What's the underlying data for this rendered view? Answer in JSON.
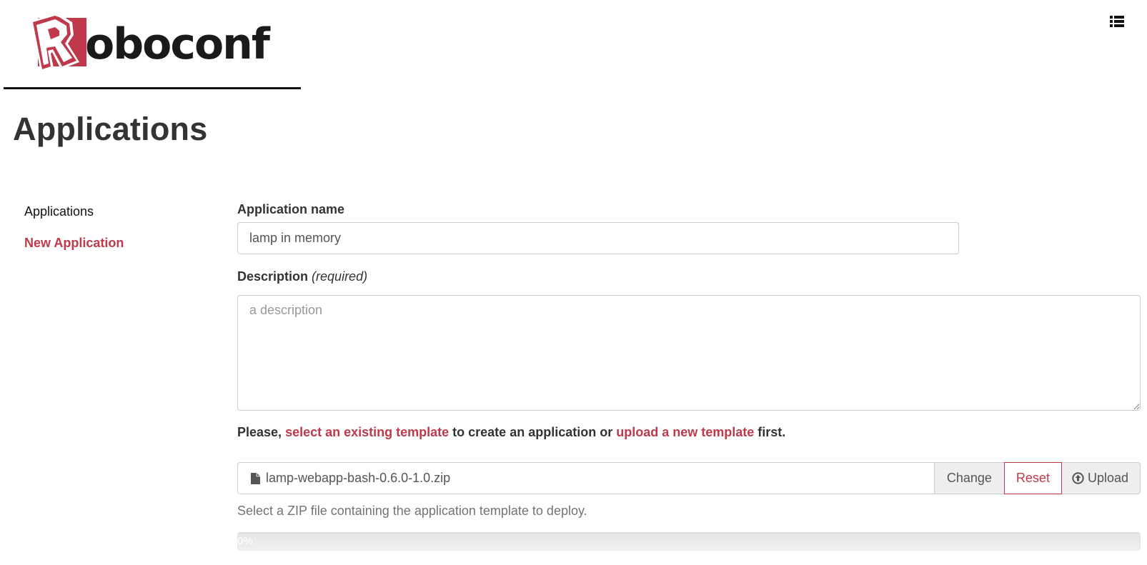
{
  "brand": {
    "logo_letter": "R",
    "logo_text": "oboconf",
    "accent_color": "#c0394b"
  },
  "header": {
    "menu_icon": "list-icon"
  },
  "page": {
    "title": "Applications"
  },
  "sidebar": {
    "items": [
      {
        "label": "Applications",
        "active": false
      },
      {
        "label": "New Application",
        "active": true
      }
    ]
  },
  "form": {
    "name_label": "Application name",
    "name_value": "lamp in memory",
    "description_label": "Description",
    "description_required": "(required)",
    "description_placeholder": "a description",
    "description_value": "",
    "hint": {
      "prefix": "Please, ",
      "link1": "select an existing template",
      "middle": " to create an application or ",
      "link2": "upload a new template",
      "suffix": " first."
    },
    "file": {
      "icon": "file-icon",
      "filename": "lamp-webapp-bash-0.6.0-1.0.zip",
      "change_label": "Change",
      "reset_label": "Reset",
      "upload_label": "Upload",
      "upload_icon": "circle-arrow-up-icon"
    },
    "help_text": "Select a ZIP file containing the application template to deploy.",
    "progress": {
      "percent": 0,
      "label": "0%"
    }
  }
}
